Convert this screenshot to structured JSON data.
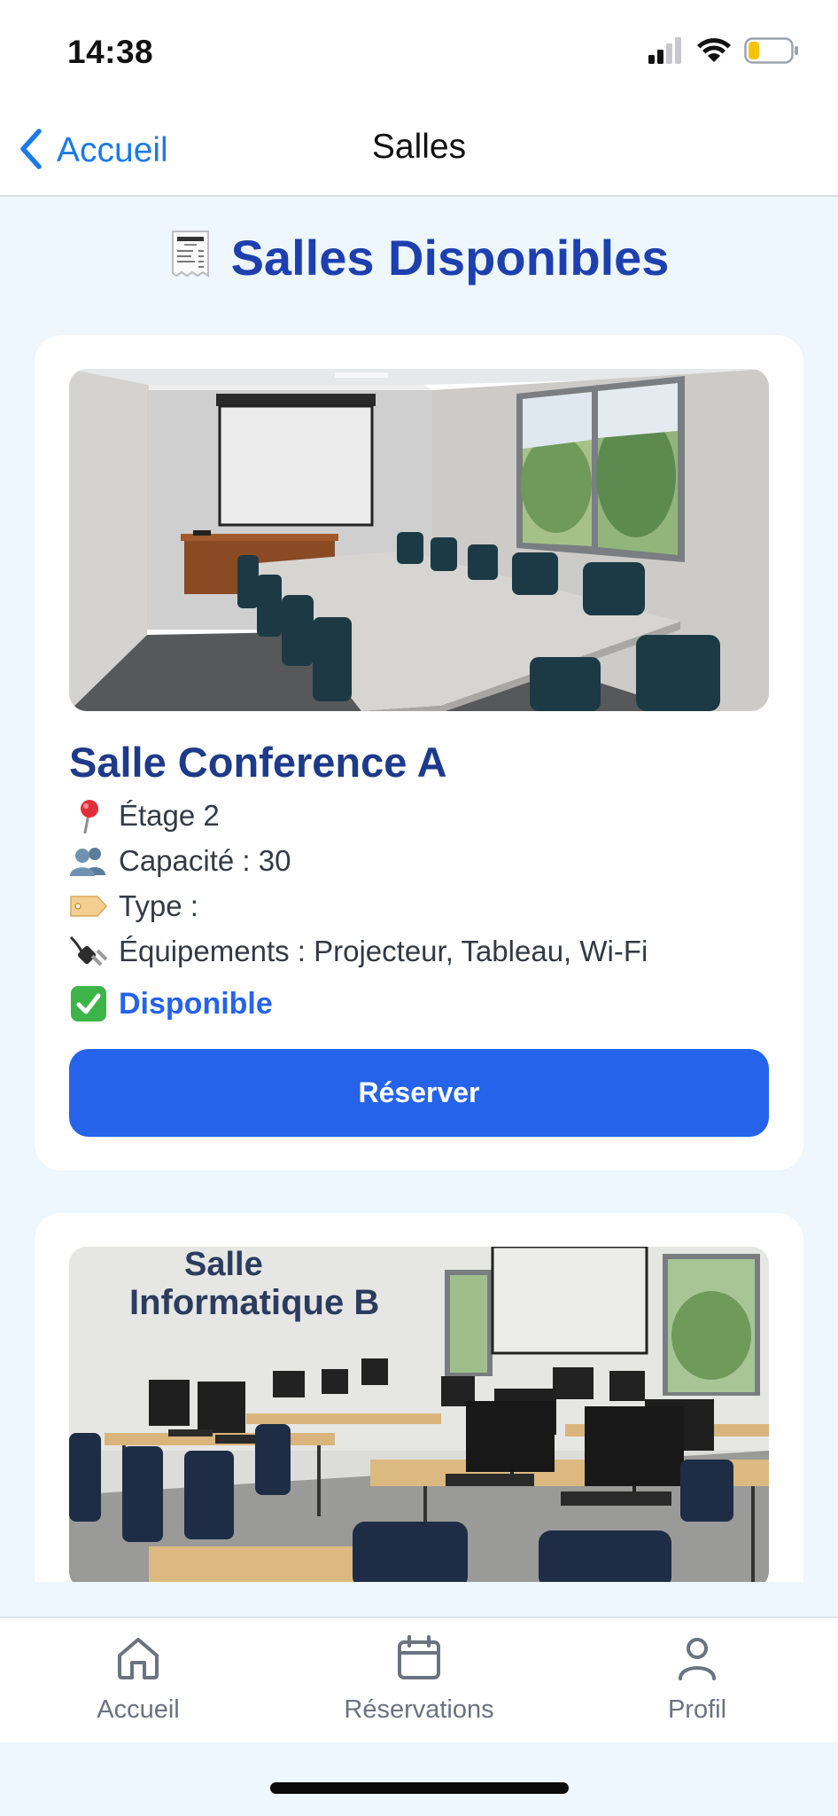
{
  "status_bar": {
    "time": "14:38",
    "icons": [
      "cellular-signal-icon",
      "wifi-icon",
      "battery-icon"
    ]
  },
  "nav": {
    "back_label": "Accueil",
    "title": "Salles"
  },
  "page": {
    "title_icon": "receipt-icon",
    "title": "Salles Disponibles"
  },
  "rooms": [
    {
      "photo": "conference-room-photo",
      "name": "Salle Conference A",
      "floor": "Étage 2",
      "capacity": "Capacité : 30",
      "type": "Type :",
      "equipment": "Équipements : Projecteur, Tableau, Wi-Fi",
      "status": "Disponible",
      "reserve_label": "Réserver"
    },
    {
      "photo": "computer-lab-photo",
      "photo_sign_line1": "Salle",
      "photo_sign_line2": "Informatique B"
    }
  ],
  "tabs": [
    {
      "label": "Accueil",
      "icon": "home-icon"
    },
    {
      "label": "Réservations",
      "icon": "calendar-icon"
    },
    {
      "label": "Profil",
      "icon": "person-icon"
    }
  ],
  "colors": {
    "accent": "#2563eb",
    "heading": "#1e40af",
    "background": "#eef6fe",
    "ios_link": "#1d7ae8"
  }
}
